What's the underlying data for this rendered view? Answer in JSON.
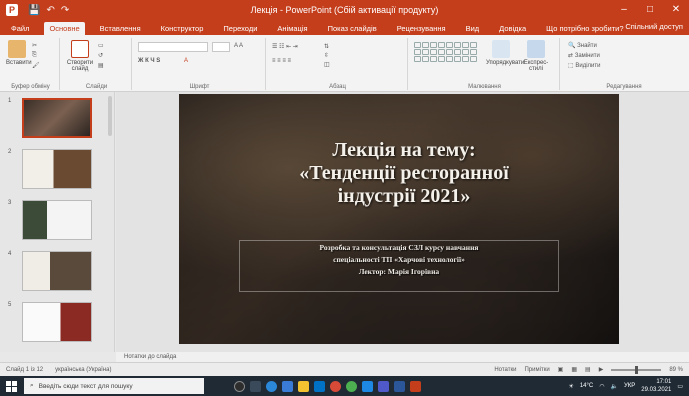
{
  "window": {
    "app_icon": "P",
    "doc_title": "Лекція - PowerPoint (Сбій активації продукту)",
    "qat": [
      "save-icon",
      "undo-icon",
      "redo-icon"
    ],
    "controls": [
      "–",
      "□",
      "✕"
    ]
  },
  "ribbon_tabs": [
    {
      "label": "Файл"
    },
    {
      "label": "Основне",
      "active": true
    },
    {
      "label": "Вставлення"
    },
    {
      "label": "Конструктор"
    },
    {
      "label": "Переходи"
    },
    {
      "label": "Анімація"
    },
    {
      "label": "Показ слайдів"
    },
    {
      "label": "Рецензування"
    },
    {
      "label": "Вид"
    },
    {
      "label": "Довідка"
    },
    {
      "label": "Що потрібно зробити?"
    }
  ],
  "share_label": "Спільний доступ",
  "ribbon_groups": {
    "clipboard": {
      "label": "Буфер обміну",
      "paste": "Вставити"
    },
    "slides": {
      "label": "Слайди",
      "new_slide": "Створити слайд"
    },
    "font": {
      "label": "Шрифт"
    },
    "paragraph": {
      "label": "Абзац"
    },
    "drawing": {
      "label": "Малювання",
      "arrange": "Упорядкувати",
      "styles": "Експрес-стилі"
    },
    "editing": {
      "label": "Редагування",
      "find": "Знайти",
      "replace": "Замінити",
      "select": "Виділити"
    }
  },
  "slide": {
    "title_lines": [
      "Лекція на тему:",
      "«Тенденції ресторанної",
      "індустрії 2021»"
    ],
    "subtitle_lines": [
      "Розробка та консультація СЗЛ курсу навчання",
      "спеціальності ТП «Харчові технології»",
      "Лектор: Марія Ігорівна"
    ]
  },
  "thumbnails": [
    {
      "num": "1",
      "selected": true
    },
    {
      "num": "2"
    },
    {
      "num": "3"
    },
    {
      "num": "4"
    },
    {
      "num": "5"
    }
  ],
  "notes_placeholder": "Нотатки до слайда",
  "status": {
    "slide_info": "Слайд 1 із 12",
    "language": "українська (Україна)",
    "notes": "Нотатки",
    "comments": "Примітки",
    "zoom": "89 %"
  },
  "taskbar": {
    "search_placeholder": "Введіть сюди текст для пошуку",
    "weather": "14°С",
    "time": "17:01",
    "date": "29.03.2021",
    "lang": "УКР"
  },
  "colors": {
    "accent": "#c43e1c",
    "taskbar": "#1f2a35"
  }
}
